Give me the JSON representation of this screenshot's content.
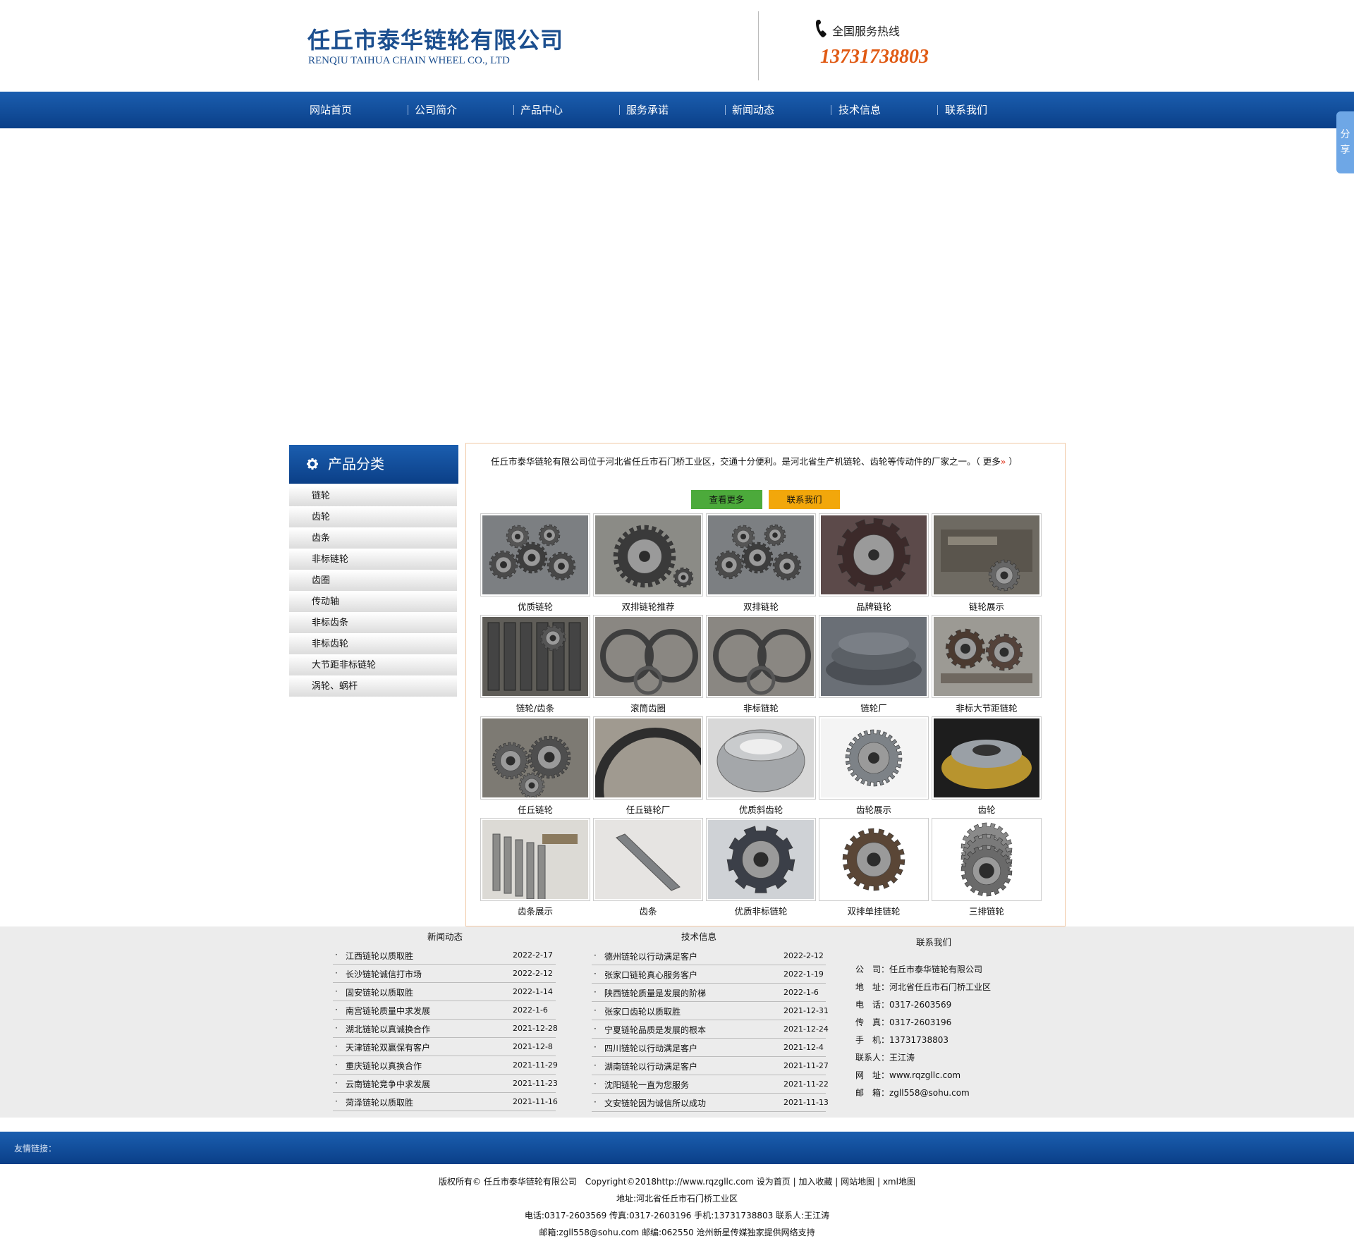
{
  "header": {
    "company_cn": "任丘市泰华链轮有限公司",
    "company_en": "RENQIU TAIHUA CHAIN WHEEL CO., LTD",
    "hotline_label": "全国服务热线",
    "hotline_number": "13731738803",
    "brand_color": "#1c4f8f",
    "hotline_color": "#e05a14"
  },
  "nav": {
    "items": [
      "网站首页",
      "公司简介",
      "产品中心",
      "服务承诺",
      "新闻动态",
      "技术信息",
      "联系我们"
    ],
    "bg_color": "#0a3f88"
  },
  "share": {
    "label_1": "分",
    "label_2": "享"
  },
  "sidebar": {
    "title": "产品分类",
    "items": [
      "链轮",
      "齿轮",
      "齿条",
      "非标链轮",
      "齿圈",
      "传动轴",
      "非标齿条",
      "非标齿轮",
      "大节距非标链轮",
      "涡轮、蜗杆"
    ]
  },
  "intro": {
    "text": "任丘市泰华链轮有限公司位于河北省任丘市石门桥工业区，交通十分便利。是河北省生产机链轮、齿轮等传动件的厂家之一。（",
    "more_label": "更多",
    "more_arrow": "»",
    "close_paren": "）",
    "btn_more": "查看更多",
    "btn_contact": "联系我们"
  },
  "products": [
    {
      "caption": "优质链轮",
      "icon": "sprocket-pile"
    },
    {
      "caption": "双排链轮推荐",
      "icon": "double-sprocket"
    },
    {
      "caption": "双排链轮",
      "icon": "sprocket-pile"
    },
    {
      "caption": "品牌链轮",
      "icon": "large-sprocket"
    },
    {
      "caption": "链轮展示",
      "icon": "workshop"
    },
    {
      "caption": "链轮/齿条",
      "icon": "gear-rack-stack"
    },
    {
      "caption": "滚筒齿圈",
      "icon": "ring-gears"
    },
    {
      "caption": "非标链轮",
      "icon": "ring-gears"
    },
    {
      "caption": "链轮厂",
      "icon": "stacked-discs"
    },
    {
      "caption": "非标大节距链轮",
      "icon": "pallet-sprockets"
    },
    {
      "caption": "任丘链轮",
      "icon": "gear-pile"
    },
    {
      "caption": "任丘链轮厂",
      "icon": "large-ring-gear"
    },
    {
      "caption": "优质斜齿轮",
      "icon": "helical-gear"
    },
    {
      "caption": "齿轮展示",
      "icon": "bevel-gear"
    },
    {
      "caption": "齿轮",
      "icon": "brass-gear"
    },
    {
      "caption": "齿条展示",
      "icon": "racks"
    },
    {
      "caption": "齿条",
      "icon": "single-rack"
    },
    {
      "caption": "优质非标链轮",
      "icon": "nonstandard-sprocket"
    },
    {
      "caption": "双排单挂链轮",
      "icon": "double-single-sprocket"
    },
    {
      "caption": "三排链轮",
      "icon": "triple-sprocket"
    }
  ],
  "news": {
    "title": "新闻动态",
    "items": [
      {
        "title": "江西链轮以质取胜",
        "date": "2022-2-17"
      },
      {
        "title": "长沙链轮诚信打市场",
        "date": "2022-2-12"
      },
      {
        "title": "固安链轮以质取胜",
        "date": "2022-1-14"
      },
      {
        "title": "南宫链轮质量中求发展",
        "date": "2022-1-6"
      },
      {
        "title": "湖北链轮以真诚换合作",
        "date": "2021-12-28"
      },
      {
        "title": "天津链轮双赢保有客户",
        "date": "2021-12-8"
      },
      {
        "title": "重庆链轮以真换合作",
        "date": "2021-11-29"
      },
      {
        "title": "云南链轮竞争中求发展",
        "date": "2021-11-23"
      },
      {
        "title": "菏泽链轮以质取胜",
        "date": "2021-11-16"
      }
    ]
  },
  "tech": {
    "title": "技术信息",
    "items": [
      {
        "title": "德州链轮以行动满足客户",
        "date": "2022-2-12"
      },
      {
        "title": "张家口链轮真心服务客户",
        "date": "2022-1-19"
      },
      {
        "title": "陕西链轮质量是发展的阶梯",
        "date": "2022-1-6"
      },
      {
        "title": "张家口齿轮以质取胜",
        "date": "2021-12-31"
      },
      {
        "title": "宁夏链轮品质是发展的根本",
        "date": "2021-12-24"
      },
      {
        "title": "四川链轮以行动满足客户",
        "date": "2021-12-4"
      },
      {
        "title": "湖南链轮以行动满足客户",
        "date": "2021-11-27"
      },
      {
        "title": "沈阳链轮一直为您服务",
        "date": "2021-11-22"
      },
      {
        "title": "文安链轮因为诚信所以成功",
        "date": "2021-11-13"
      }
    ]
  },
  "contact": {
    "title": "联系我们",
    "lines": [
      "公　司：任丘市泰华链轮有限公司",
      "地　址：河北省任丘市石门桥工业区",
      "电　话：0317-2603569",
      "传　真：0317-2603196",
      "手　机：13731738803",
      "联系人：王江涛",
      "网　址：www.rqzgllc.com",
      "邮　箱：zgll558@sohu.com"
    ]
  },
  "friend_links": {
    "label": "友情链接："
  },
  "footer": {
    "copyright": "版权所有© 任丘市泰华链轮有限公司　Copyright©2018http://www.rqzgllc.com",
    "link_home": "设为首页",
    "link_fav": "加入收藏",
    "link_map": "网站地图",
    "link_xml": "xml地图",
    "address": "地址:河北省任丘市石门桥工业区",
    "phones": "电话:0317-2603569 传真:0317-2603196 手机:13731738803 联系人:王江涛",
    "mail": "邮箱:zgll558@sohu.com 邮编:062550 沧州新星传媒独家提供网络支持"
  }
}
